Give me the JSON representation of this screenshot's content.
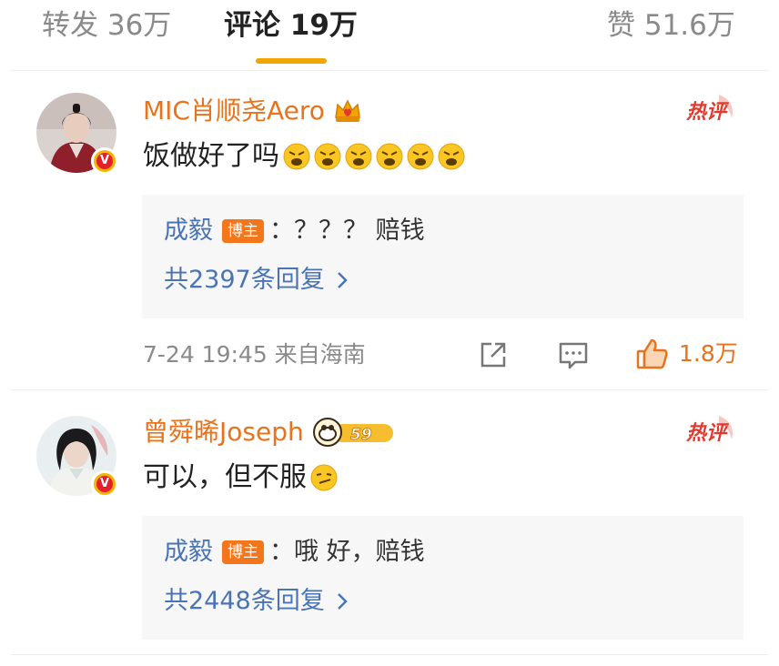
{
  "tabs": [
    {
      "label": "转发 36万"
    },
    {
      "label": "评论 19万"
    },
    {
      "label": "赞 51.6万"
    }
  ],
  "colors": {
    "accent": "#f2a400",
    "username": "#e8731c",
    "link": "#4a74b5",
    "hot": "#e23a2e"
  },
  "comments": [
    {
      "username": "MIC肖顺尧Aero",
      "user_badge_icon": "crown-icon",
      "hot_label": "热评",
      "text": "饭做好了吗",
      "emoji_icon": "angry-face-icon",
      "reply": {
        "author": "成毅",
        "badge": "博主",
        "text": "：？？？ 赔钱",
        "more": "共2397条回复"
      },
      "meta": "7-24 19:45 来自海南",
      "likes": "1.8万"
    },
    {
      "username": "曾舜晞Joseph",
      "user_badge_icon": "level-badge-icon",
      "user_badge_level": "59",
      "hot_label": "热评",
      "text": "可以，但不服",
      "emoji_icon": "smirk-face-icon",
      "reply": {
        "author": "成毅",
        "badge": "博主",
        "text": "：哦 好，赔钱",
        "more": "共2448条回复"
      }
    }
  ]
}
